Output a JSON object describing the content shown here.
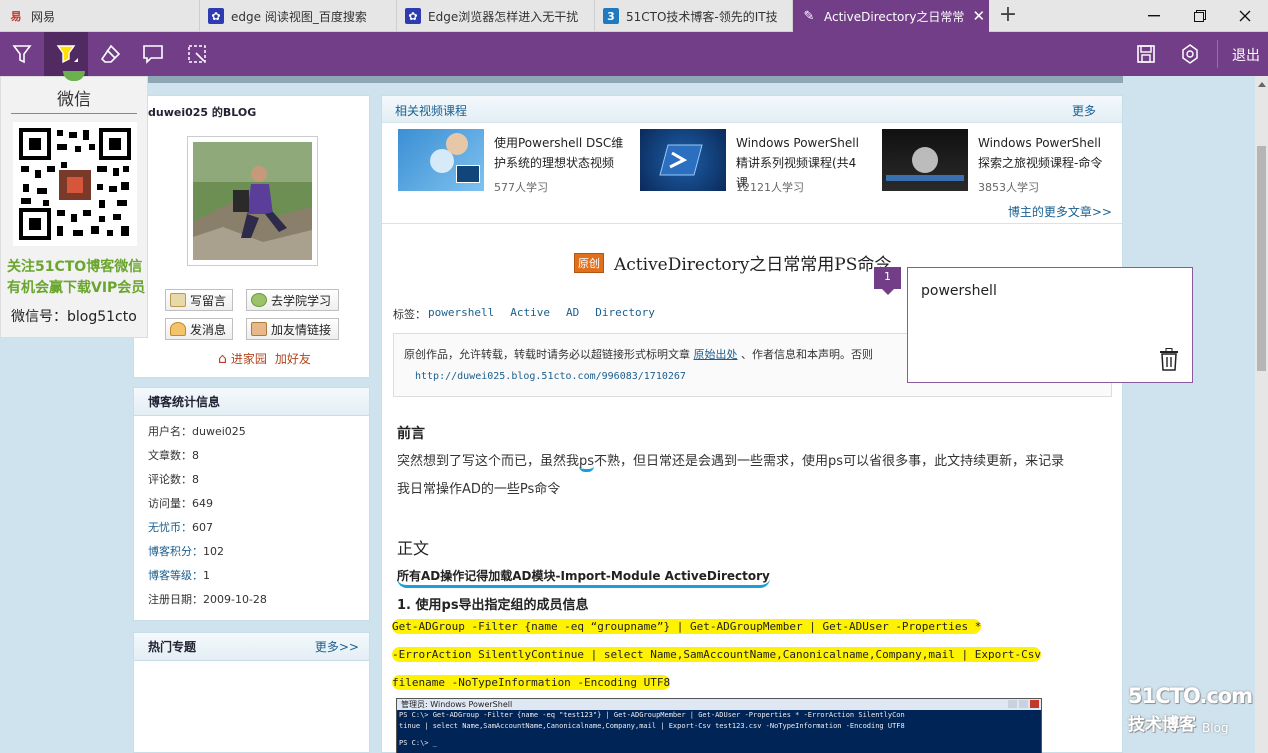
{
  "browser": {
    "tabs": [
      {
        "label": "网易",
        "favicon": "netease-icon",
        "color": "#c0392b"
      },
      {
        "label": "edge 阅读视图_百度搜索",
        "favicon": "baidu-paw-icon",
        "color": "#2f3bb0"
      },
      {
        "label": "Edge浏览器怎样进入无干扰",
        "favicon": "baidu-paw-icon",
        "color": "#2f3bb0"
      },
      {
        "label": "51CTO技术博客-领先的IT技",
        "favicon": "51cto-icon",
        "color": "#1f7ac2"
      },
      {
        "label": "ActiveDirectory之日常常",
        "favicon": "webnote-icon",
        "active": true
      }
    ],
    "new_tab": "+",
    "window_controls": [
      "minimize-icon",
      "restore-icon",
      "close-icon"
    ]
  },
  "note_toolbar": {
    "tools": [
      "pen-icon",
      "highlighter-icon",
      "eraser-icon",
      "comment-icon",
      "clip-icon"
    ],
    "right_tools": [
      "save-icon",
      "share-icon"
    ],
    "exit_label": "退出"
  },
  "wechat": {
    "title": "微信",
    "promo_line1": "关注51CTO博客微信",
    "promo_line2": "有机会赢下载VIP会员",
    "account": "微信号：blog51cto"
  },
  "profile": {
    "blog_title": "duwei025 的BLOG",
    "buttons": [
      "写留言",
      "去学院学习",
      "发消息",
      "加友情链接"
    ],
    "home_link": "进家园",
    "add_friend": "加好友"
  },
  "stats": {
    "title": "博客统计信息",
    "rows": [
      {
        "k": "用户名：",
        "v": "duwei025",
        "link": false
      },
      {
        "k": "文章数：",
        "v": "8",
        "link": false
      },
      {
        "k": "评论数：",
        "v": "8",
        "link": false
      },
      {
        "k": "访问量：",
        "v": "649",
        "link": false
      },
      {
        "k": "无忧币：",
        "v": "607",
        "link": true
      },
      {
        "k": "博客积分：",
        "v": "102",
        "link": true
      },
      {
        "k": "博客等级：",
        "v": "1",
        "link": true
      },
      {
        "k": "注册日期：",
        "v": "2009-10-28",
        "link": false
      }
    ]
  },
  "hot_topics": {
    "title": "热门专题",
    "more": "更多>>"
  },
  "videos": {
    "header": "相关视频课程",
    "more": "更多",
    "items": [
      {
        "title": "使用Powershell DSC维护系统的理想状态视频",
        "count": "577人学习"
      },
      {
        "title": "Windows PowerShell精讲系列视频课程(共4课",
        "count": "12121人学习"
      },
      {
        "title": "Windows PowerShell探索之旅视频课程-命令",
        "count": "3853人学习"
      }
    ],
    "blogger_more": "博主的更多文章>>"
  },
  "article": {
    "badge": "原创",
    "title": "ActiveDirectory之日常常用PS命令",
    "tags_label": "标签：",
    "tags": [
      "powershell",
      "Active",
      "AD",
      "Directory"
    ],
    "copyright": "原创作品，允许转载，转载时请务必以超链接形式标明文章",
    "copyright_link": "原始出处",
    "copyright_tail": "、作者信息和本声明。否则",
    "url": "http://duwei025.blog.51cto.com/996083/1710267",
    "preface_title": "前言",
    "preface_a": "突然想到了写这个而已，虽然我",
    "preface_ps": "ps",
    "preface_b": "不熟，但日常还是会遇到一些需求，使用ps可以省很多事，此文持续更新，来记录",
    "preface_c": "我日常操作AD的一些Ps命令",
    "body_title": "正文",
    "ad_note": "所有AD操作记得加载AD模块-Import-Module ActiveDirectory",
    "step1": "1.  使用ps导出指定组的成员信息",
    "code1": "Get-ADGroup -Filter {name -eq “groupname”} | Get-ADGroupMember | Get-ADUser -Properties *",
    "code2": "-ErrorAction SilentlyContinue | select Name,SamAccountName,Canonicalname,Company,mail | Export-Csv",
    "code3": "filename -NoTypeInformation -Encoding UTF8"
  },
  "console": {
    "title": "管理员: Windows PowerShell",
    "line1": "PS C:\\> Get-ADGroup -Filter {name -eq \"test123\"} | Get-ADGroupMember | Get-ADUser -Properties * -ErrorAction SilentlyCon",
    "line2": "tinue | select Name,SamAccountName,Canonicalname,Company,mail | Export-Csv test123.csv -NoTypeInformation -Encoding UTF8",
    "line3": "PS C:\\> _"
  },
  "note": {
    "number": "1",
    "text": "powershell"
  },
  "watermark": {
    "brand": "51CTO.com",
    "sub": "技术博客",
    "blog": "Blog"
  }
}
